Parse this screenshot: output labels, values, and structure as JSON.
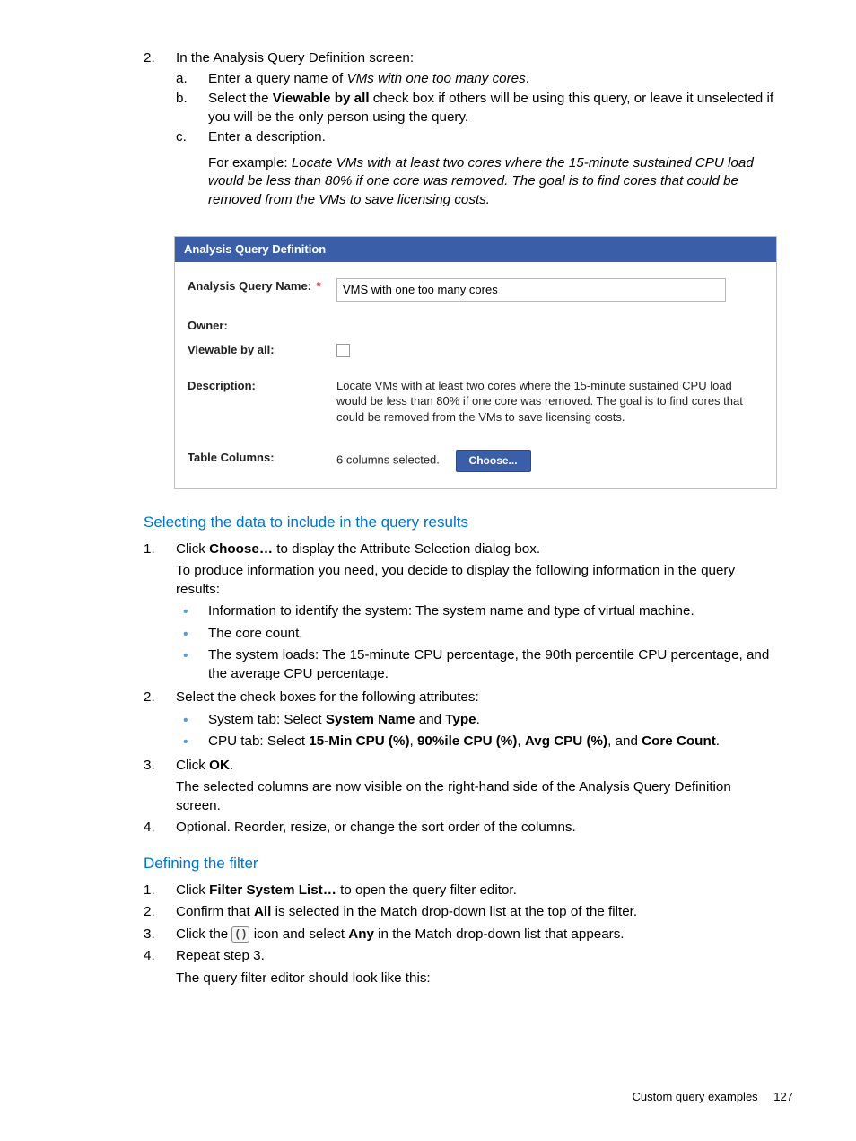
{
  "step2": {
    "num": "2.",
    "intro": "In the Analysis Query Definition screen:",
    "a": {
      "num": "a.",
      "pre": "Enter a query name of ",
      "ital": "VMs with one too many cores",
      "post": "."
    },
    "b": {
      "num": "b.",
      "pre": "Select the ",
      "bold": "Viewable by all",
      "post": " check box if others will be using this query, or leave it unselected if you will be the only person using the query."
    },
    "c": {
      "num": "c.",
      "line1": "Enter a description.",
      "ex_pre": "For example: ",
      "ex_ital": "Locate VMs with at least two cores where the 15-minute sustained CPU load would be less than 80% if one core was removed. The goal is to find cores that could be removed from the VMs to save licensing costs."
    }
  },
  "panel": {
    "title": "Analysis Query Definition",
    "name_label": "Analysis Query Name:",
    "name_value": "VMS with one too many cores",
    "owner_label": "Owner:",
    "owner_value": "",
    "viewable_label": "Viewable by all:",
    "desc_label": "Description:",
    "desc_value": "Locate VMs with at least two cores where the 15-minute sustained CPU load would be less than 80% if one core was removed. The goal is to find cores that could be removed from the VMs to save licensing costs.",
    "tablecols_label": "Table Columns:",
    "tablecols_value": "6 columns selected.",
    "choose_btn": "Choose..."
  },
  "selecting": {
    "heading": "Selecting the data to include in the query results",
    "s1": {
      "num": "1.",
      "pre": "Click ",
      "bold": "Choose…",
      "post": " to display the Attribute Selection dialog box.",
      "para": "To produce information you need, you decide to display the following information in the query results:",
      "b1": "Information to identify the system: The system name and type of virtual machine.",
      "b2": "The core count.",
      "b3": "The system loads: The 15-minute CPU percentage, the 90th percentile CPU percentage, and the average CPU percentage."
    },
    "s2": {
      "num": "2.",
      "intro": "Select the check boxes for the following attributes:",
      "b1_pre": "System tab: Select ",
      "b1_bold1": "System Name",
      "b1_mid": " and ",
      "b1_bold2": "Type",
      "b1_post": ".",
      "b2_pre": "CPU tab: Select ",
      "b2_bold1": "15-Min CPU (%)",
      "b2_c1": ", ",
      "b2_bold2": "90%ile CPU (%)",
      "b2_c2": ", ",
      "b2_bold3": "Avg CPU (%)",
      "b2_c3": ", and ",
      "b2_bold4": "Core Count",
      "b2_post": "."
    },
    "s3": {
      "num": "3.",
      "pre": "Click ",
      "bold": "OK",
      "post": ".",
      "para": "The selected columns are now visible on the right-hand side of the Analysis Query Definition screen."
    },
    "s4": {
      "num": "4.",
      "text": "Optional. Reorder, resize, or change the sort order of the columns."
    }
  },
  "defining": {
    "heading": "Defining the filter",
    "s1": {
      "num": "1.",
      "pre": "Click ",
      "bold": "Filter System List…",
      "post": " to open the query filter editor."
    },
    "s2": {
      "num": "2.",
      "pre": "Confirm that ",
      "bold": "All",
      "post": " is selected in the Match drop-down list at the top of the filter."
    },
    "s3": {
      "num": "3.",
      "pre": "Click the ",
      "icon": "( )",
      "mid": " icon and select ",
      "bold": "Any",
      "post": " in the Match drop-down list that appears."
    },
    "s4": {
      "num": "4.",
      "line1": "Repeat step 3.",
      "line2": "The query filter editor should look like this:"
    }
  },
  "footer": {
    "text": "Custom query examples",
    "page": "127"
  }
}
